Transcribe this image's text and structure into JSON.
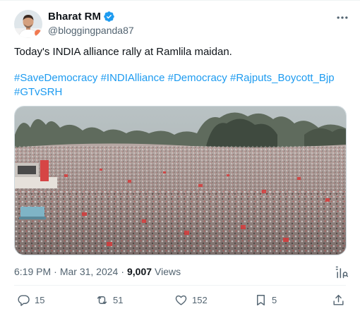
{
  "author": {
    "name": "Bharat RM",
    "handle": "@bloggingpanda87",
    "verified_color": "#1d9bf0"
  },
  "tweet": {
    "text": "Today's INDIA alliance rally at Ramlila maidan.",
    "hashtags": [
      "#SaveDemocracy",
      "#INDIAlliance",
      "#Democracy",
      "#Rajputs_Boycott_Bjp",
      "#GTvSRH"
    ]
  },
  "meta": {
    "time": "6:19 PM",
    "date": "Mar 31, 2024",
    "views_count": "9,007",
    "views_label": "Views"
  },
  "actions": {
    "replies": "15",
    "reposts": "51",
    "likes": "152",
    "bookmarks": "5"
  },
  "icons": {
    "more": "more-horizontal-icon",
    "verified": "verified-badge-icon",
    "reply": "reply-icon",
    "repost": "repost-icon",
    "like": "heart-icon",
    "bookmark": "bookmark-icon",
    "share": "share-icon",
    "analytics": "analytics-icon"
  },
  "colors": {
    "text_primary": "#0f1419",
    "text_secondary": "#536471",
    "link": "#1d9bf0"
  }
}
